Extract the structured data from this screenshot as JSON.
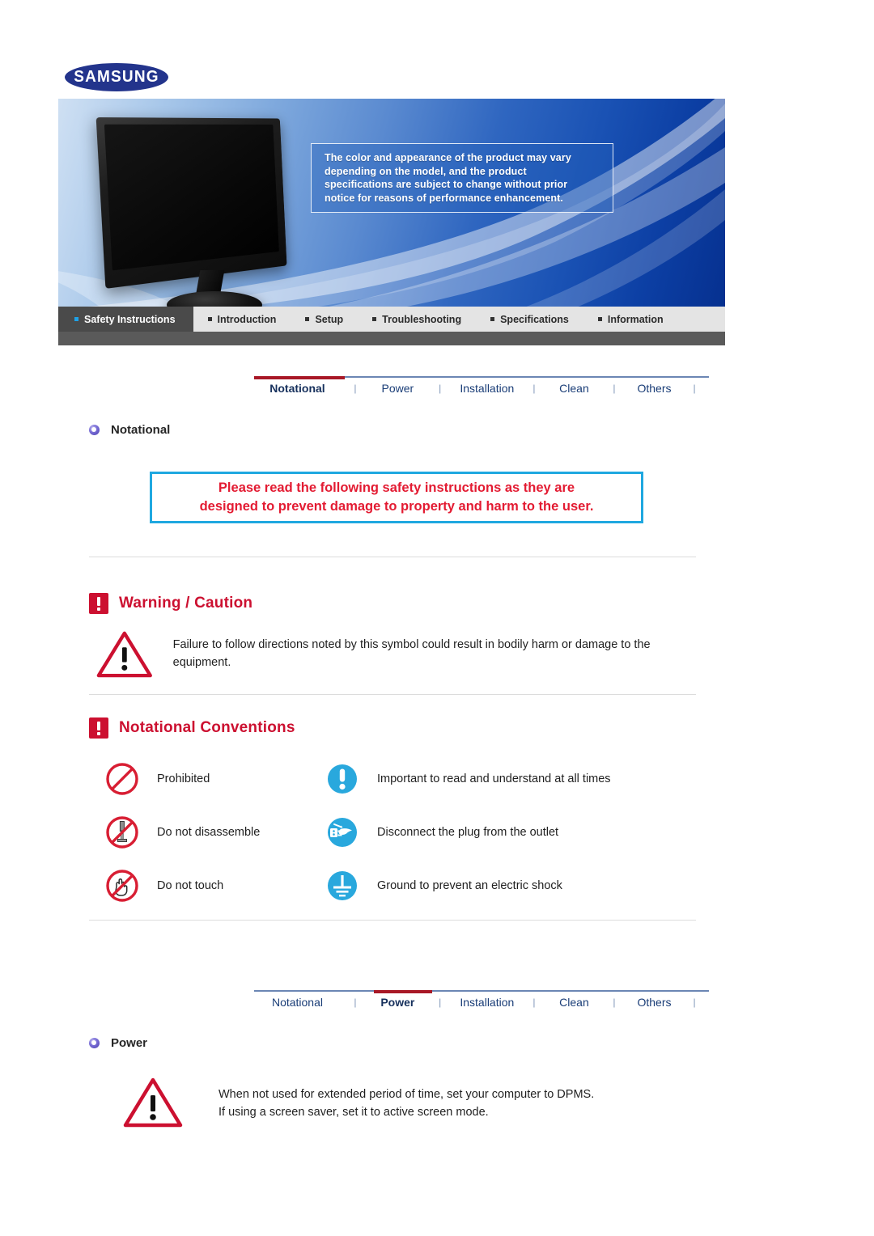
{
  "brand": {
    "logo_text": "SAMSUNG"
  },
  "banner": {
    "notice_lines": [
      "The color and appearance of the product may vary",
      "depending on the model, and the product",
      "specifications are subject to change without prior",
      "notice for reasons of performance enhancement."
    ]
  },
  "main_nav": {
    "items": [
      {
        "label": "Safety Instructions",
        "active": true
      },
      {
        "label": "Introduction",
        "active": false
      },
      {
        "label": "Setup",
        "active": false
      },
      {
        "label": "Troubleshooting",
        "active": false
      },
      {
        "label": "Specifications",
        "active": false
      },
      {
        "label": "Information",
        "active": false
      }
    ]
  },
  "sub_nav_top": {
    "items": [
      "Notational",
      "Power",
      "Installation",
      "Clean",
      "Others"
    ],
    "active": "Notational",
    "separator": "|"
  },
  "sub_nav_bottom": {
    "items": [
      "Notational",
      "Power",
      "Installation",
      "Clean",
      "Others"
    ],
    "active": "Power",
    "separator": "|"
  },
  "sections": {
    "notational": {
      "heading": "Notational",
      "notice_line1": "Please read the following safety instructions as they are",
      "notice_line2": "designed to prevent damage to property and harm to the user.",
      "warning_caution": {
        "heading": "Warning / Caution",
        "text": "Failure to follow directions noted by this symbol could result in bodily harm or damage to the equipment."
      },
      "conventions": {
        "heading": "Notational Conventions",
        "rows": [
          {
            "left_icon": "prohibited-icon",
            "left_text": "Prohibited",
            "right_icon": "important-exclamation-icon",
            "right_text": "Important to read and understand at all times"
          },
          {
            "left_icon": "do-not-disassemble-icon",
            "left_text": "Do not disassemble",
            "right_icon": "disconnect-plug-icon",
            "right_text": "Disconnect the plug from the outlet"
          },
          {
            "left_icon": "do-not-touch-icon",
            "left_text": "Do not touch",
            "right_icon": "ground-icon",
            "right_text": "Ground to prevent an electric shock"
          }
        ]
      }
    },
    "power": {
      "heading": "Power",
      "warning_line1": "When not used for extended period of time, set your computer to DPMS.",
      "warning_line2": "If using a screen saver, set it to active screen mode."
    }
  },
  "colors": {
    "brand_blue": "#23348c",
    "accent_red": "#cc1030",
    "notice_red": "#e31b32",
    "notice_border_blue": "#1fa8e0",
    "nav_active_bg": "#4a4a4a",
    "sub_nav_link": "#1a3d77",
    "sub_nav_underline_red": "#a81826",
    "icon_blue": "#29a8dd",
    "icon_red": "#d81e33"
  }
}
